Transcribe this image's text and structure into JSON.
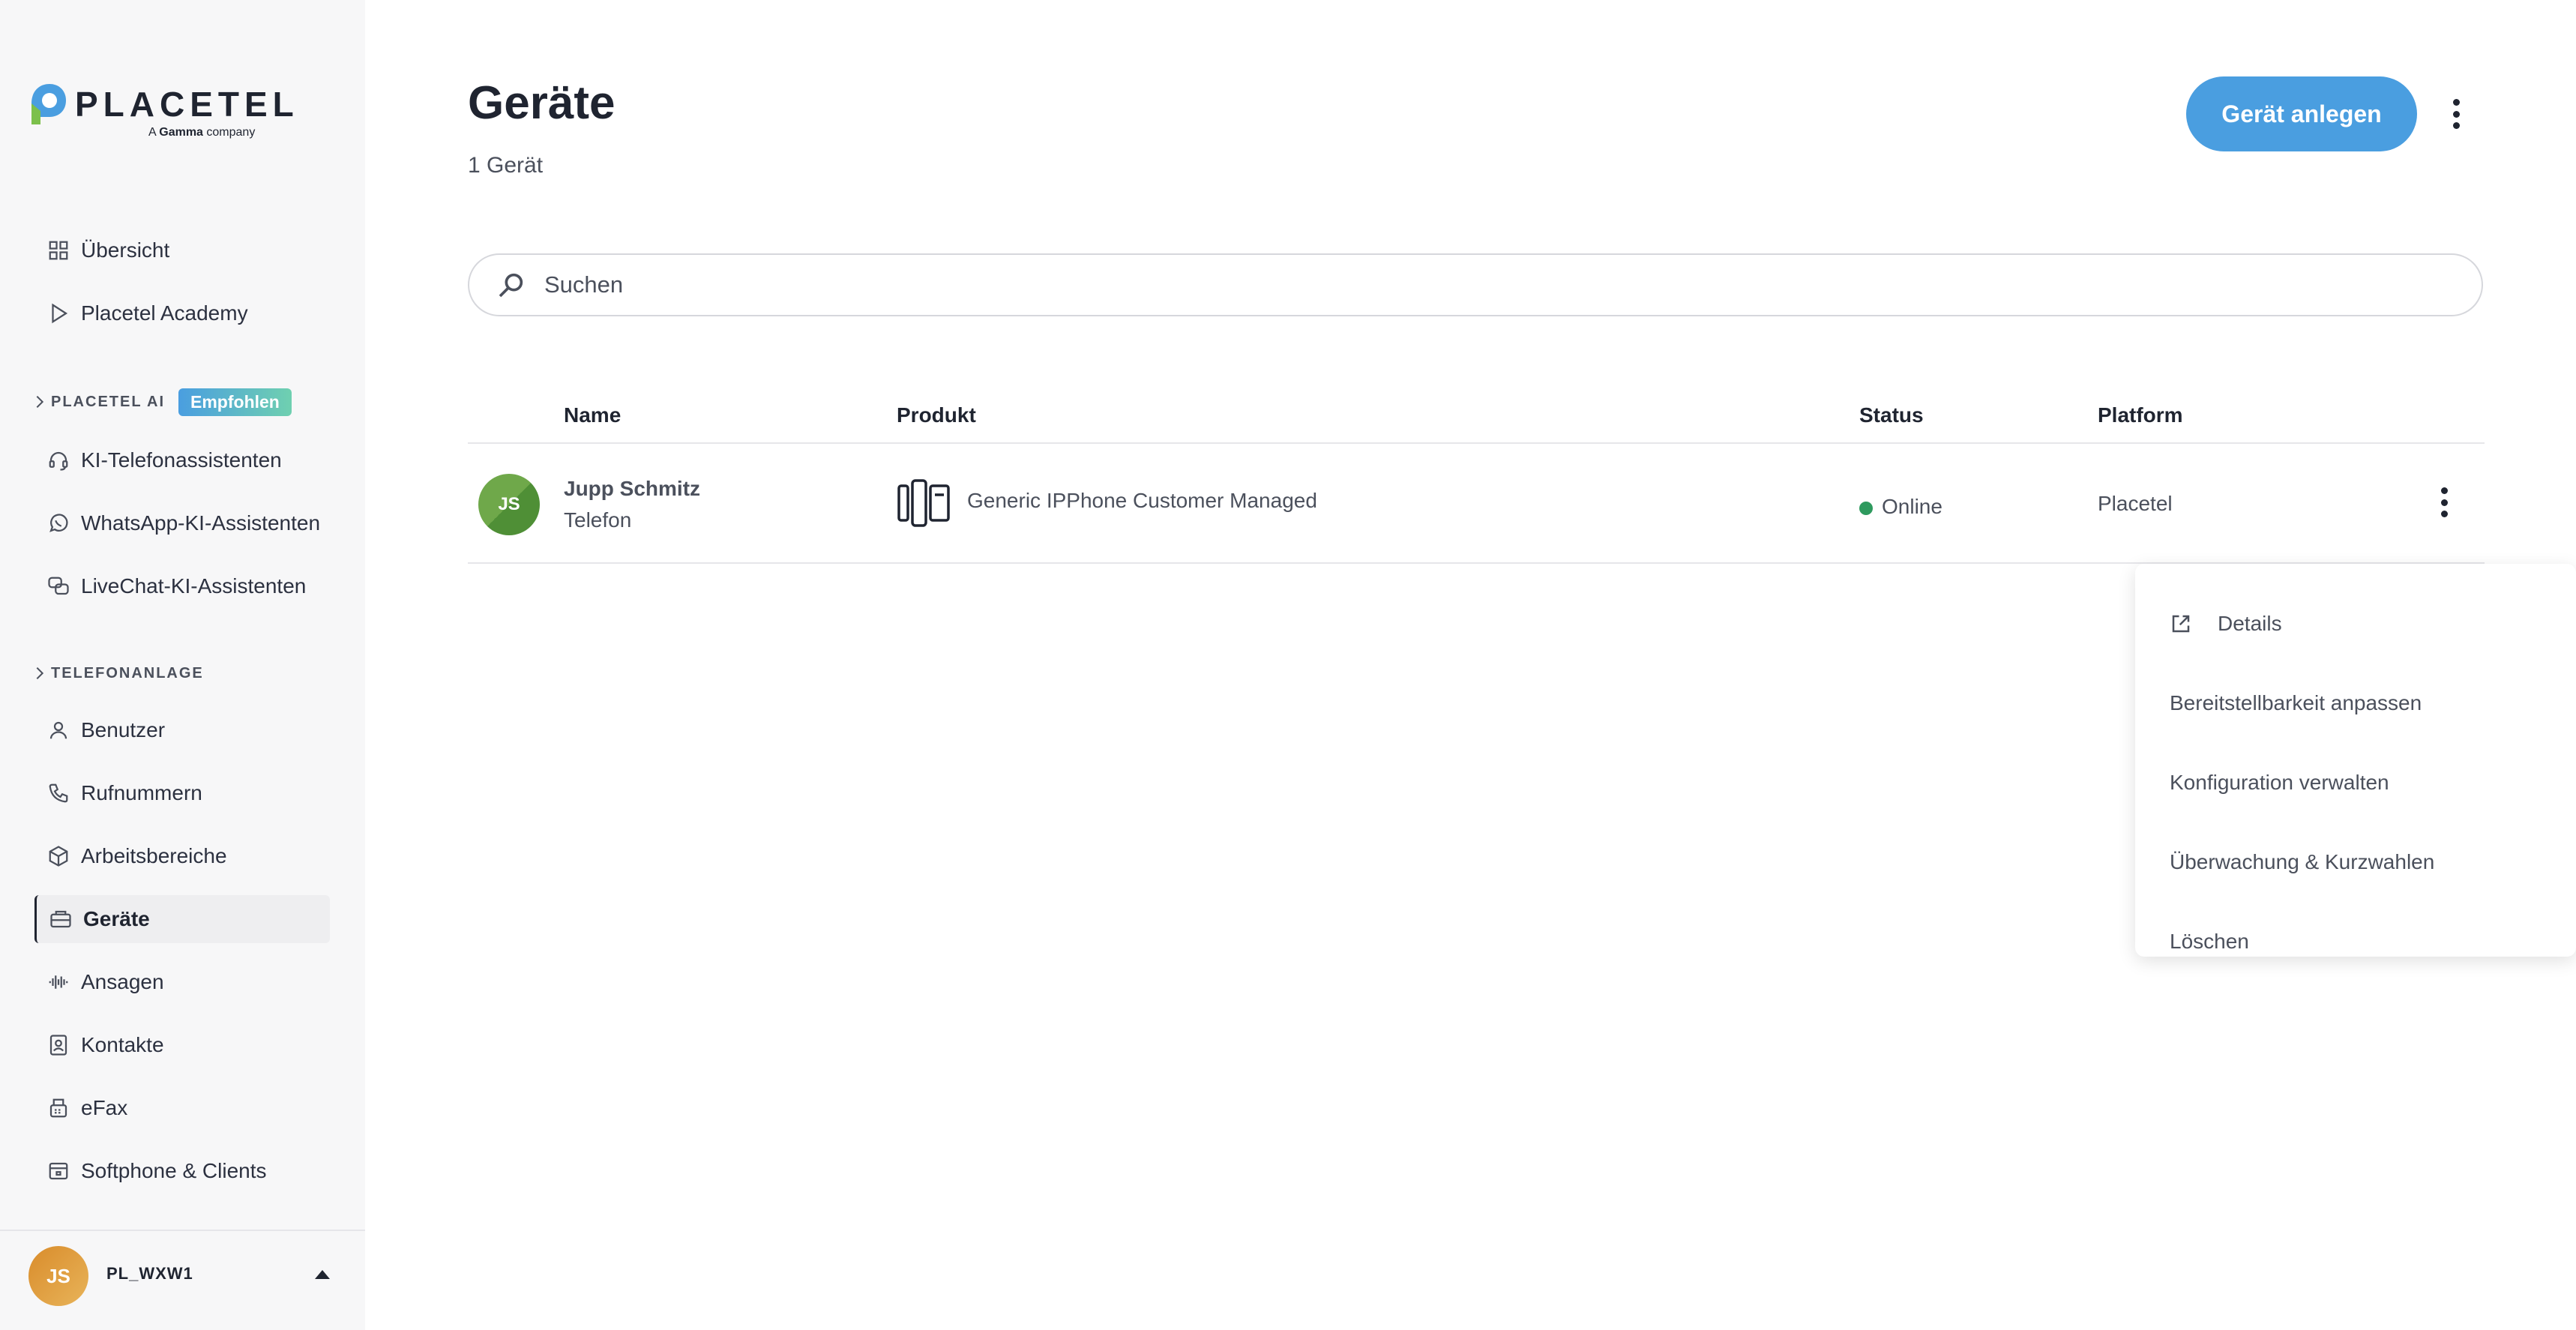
{
  "brand": {
    "name": "PLACETEL",
    "tagline_prefix": "A",
    "tagline_brand": "Gamma",
    "tagline_suffix": "company",
    "colors": {
      "accent": "#4a9ee0",
      "online": "#2e9a5e",
      "badge_from": "#4a9ee0",
      "badge_to": "#6fd0b0"
    }
  },
  "sidebar": {
    "top_items": [
      {
        "label": "Übersicht",
        "icon": "grid-icon"
      },
      {
        "label": "Placetel Academy",
        "icon": "play-icon"
      }
    ],
    "section_ai": {
      "title": "PLACETEL AI",
      "badge": "Empfohlen"
    },
    "ai_items": [
      {
        "label": "KI-Telefonassistenten",
        "icon": "headset-icon"
      },
      {
        "label": "WhatsApp-KI-Assistenten",
        "icon": "whatsapp-icon"
      },
      {
        "label": "LiveChat-KI-Assistenten",
        "icon": "chat-bubbles-icon"
      }
    ],
    "section_pbx": {
      "title": "TELEFONANLAGE"
    },
    "pbx_items": [
      {
        "label": "Benutzer",
        "icon": "user-icon"
      },
      {
        "label": "Rufnummern",
        "icon": "phone-icon"
      },
      {
        "label": "Arbeitsbereiche",
        "icon": "cube-icon"
      },
      {
        "label": "Geräte",
        "icon": "device-icon",
        "active": true
      },
      {
        "label": "Ansagen",
        "icon": "audio-wave-icon"
      },
      {
        "label": "Kontakte",
        "icon": "contact-book-icon"
      },
      {
        "label": "eFax",
        "icon": "fax-icon"
      },
      {
        "label": "Softphone & Clients",
        "icon": "window-icon"
      }
    ],
    "account": {
      "initials": "JS",
      "name": "PL_WXW1"
    }
  },
  "main": {
    "title": "Geräte",
    "count": "1 Gerät",
    "primary_button": "Gerät anlegen",
    "search": {
      "placeholder": "Suchen"
    },
    "table": {
      "columns": [
        "Name",
        "Produkt",
        "Status",
        "Platform"
      ],
      "rows": [
        {
          "initials": "JS",
          "name": "Jupp Schmitz",
          "type": "Telefon",
          "product": "Generic IPPhone Customer Managed",
          "status": "Online",
          "platform": "Placetel"
        }
      ]
    }
  },
  "row_menu": {
    "items": [
      {
        "label": "Details",
        "icon": "external-link-icon"
      },
      {
        "label": "Bereitstellbarkeit anpassen"
      },
      {
        "label": "Konfiguration verwalten"
      },
      {
        "label": "Überwachung & Kurzwahlen"
      },
      {
        "label": "Löschen"
      }
    ]
  }
}
